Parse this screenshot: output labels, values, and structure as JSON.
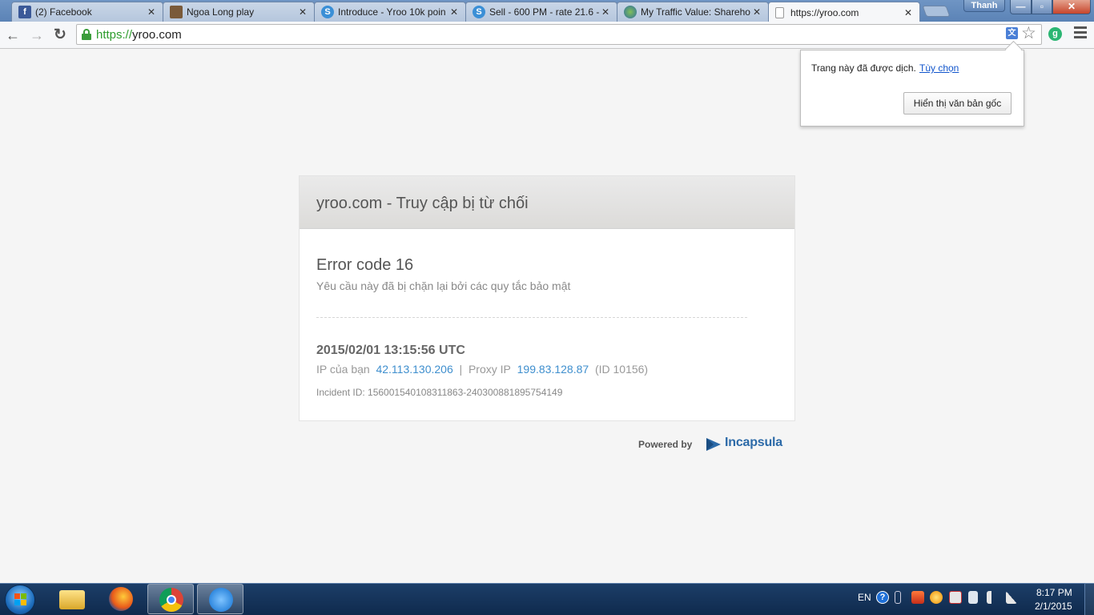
{
  "browser": {
    "tabs": [
      {
        "title": "(2) Facebook",
        "favicon": "facebook-icon",
        "color": "#3b5998",
        "glyph": "f"
      },
      {
        "title": "Ngoa Long play",
        "favicon": "game-avatar-icon",
        "color": "#7a5a3a",
        "glyph": ""
      },
      {
        "title": "Introduce - Yroo 10k poin",
        "favicon": "yroo-icon",
        "color": "#3a8fd6",
        "glyph": "S"
      },
      {
        "title": "Sell - 600 PM - rate 21.6 -",
        "favicon": "yroo-icon",
        "color": "#3a8fd6",
        "glyph": "S"
      },
      {
        "title": "My Traffic Value: Shareho",
        "favicon": "globe-icon",
        "color": "#4a8a3a",
        "glyph": ""
      },
      {
        "title": "https://yroo.com",
        "favicon": "page-icon",
        "color": "#ffffff",
        "glyph": ""
      }
    ],
    "close_glyph": "✕",
    "user_name": "Thanh",
    "window_buttons": {
      "minimize": "—",
      "maximize": "▫",
      "close": "✕"
    },
    "nav": {
      "back": "←",
      "forward": "→",
      "reload": "↻"
    },
    "url_scheme": "https://",
    "url_host": "yroo.com",
    "translate_icon_glyph": "文",
    "star_glyph": "☆",
    "extension_glyph": "g"
  },
  "translate_bubble": {
    "message": "Trang này đã được dịch.",
    "options_link": "Tùy chọn",
    "show_original_button": "Hiển thị văn bản gốc"
  },
  "error_page": {
    "header_title": "yroo.com - Truy cập bị từ chối",
    "error_code": "Error code 16",
    "description": "Yêu cầu này đã bị chặn lại bởi các quy tắc bảo mật",
    "timestamp": "2015/02/01 13:15:56 UTC",
    "ip_label": "IP của bạn",
    "ip_value": "42.113.130.206",
    "separator": "|",
    "proxy_label": "Proxy IP",
    "proxy_value": "199.83.128.87",
    "proxy_id": "(ID 10156)",
    "incident_id": "Incident ID: 156001540108311863-240300881895754149",
    "powered_by": "Powered by",
    "brand": "Incapsula"
  },
  "taskbar": {
    "language": "EN",
    "time": "8:17 PM",
    "date": "2/1/2015",
    "help_glyph": "?"
  }
}
